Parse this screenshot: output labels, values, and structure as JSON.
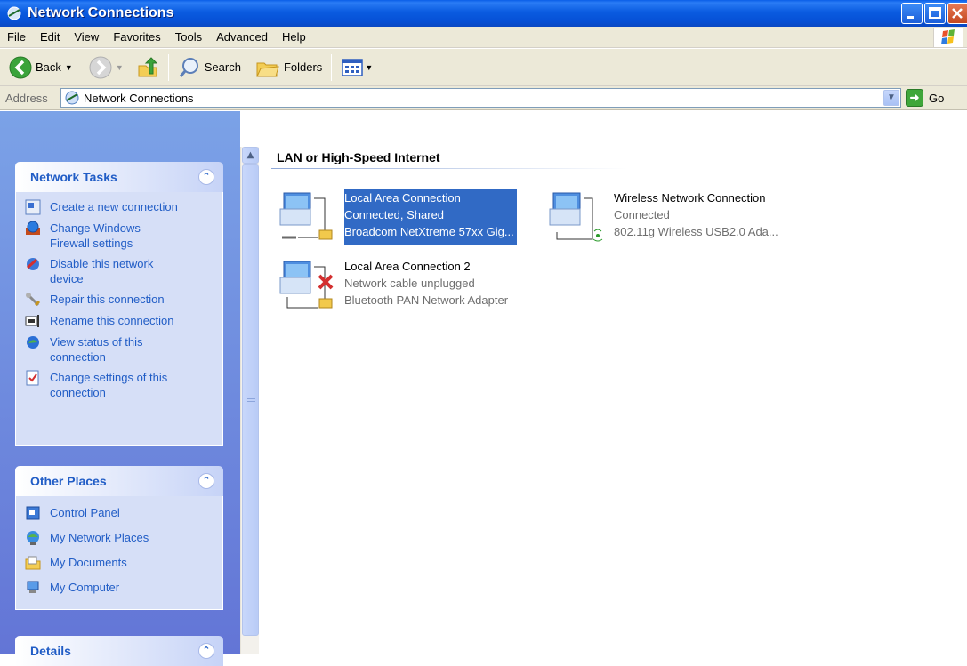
{
  "window": {
    "title": "Network Connections"
  },
  "menu": {
    "items": [
      "File",
      "Edit",
      "View",
      "Favorites",
      "Tools",
      "Advanced",
      "Help"
    ]
  },
  "toolbar": {
    "back_label": "Back",
    "search_label": "Search",
    "folders_label": "Folders"
  },
  "address": {
    "label": "Address",
    "value": "Network Connections",
    "go_label": "Go"
  },
  "panels": {
    "network_tasks": {
      "title": "Network Tasks",
      "items": [
        {
          "label": "Create a new connection",
          "icon": "new-connection-icon"
        },
        {
          "label": "Change Windows Firewall settings",
          "icon": "firewall-icon"
        },
        {
          "label": "Disable this network device",
          "icon": "disable-device-icon"
        },
        {
          "label": "Repair this connection",
          "icon": "repair-icon"
        },
        {
          "label": "Rename this connection",
          "icon": "rename-icon"
        },
        {
          "label": "View status of this connection",
          "icon": "status-icon"
        },
        {
          "label": "Change settings of this connection",
          "icon": "settings-icon"
        }
      ]
    },
    "other_places": {
      "title": "Other Places",
      "items": [
        {
          "label": "Control Panel",
          "icon": "control-panel-icon"
        },
        {
          "label": "My Network Places",
          "icon": "network-places-icon"
        },
        {
          "label": "My Documents",
          "icon": "documents-icon"
        },
        {
          "label": "My Computer",
          "icon": "computer-icon"
        }
      ]
    },
    "details": {
      "title": "Details"
    }
  },
  "content": {
    "group_title": "LAN or High-Speed Internet",
    "connections": [
      {
        "name": "Local Area Connection",
        "status": "Connected, Shared",
        "device": "Broadcom NetXtreme 57xx Gig...",
        "selected": true
      },
      {
        "name": "Wireless Network Connection",
        "status": "Connected",
        "device": "802.11g Wireless USB2.0 Ada...",
        "selected": false
      },
      {
        "name": "Local Area Connection 2",
        "status": "Network cable unplugged",
        "device": "Bluetooth PAN Network Adapter",
        "selected": false
      }
    ]
  },
  "colors": {
    "titlebar": "#0a5be0",
    "taskpane_link": "#215dc6",
    "selection": "#316ac5"
  }
}
